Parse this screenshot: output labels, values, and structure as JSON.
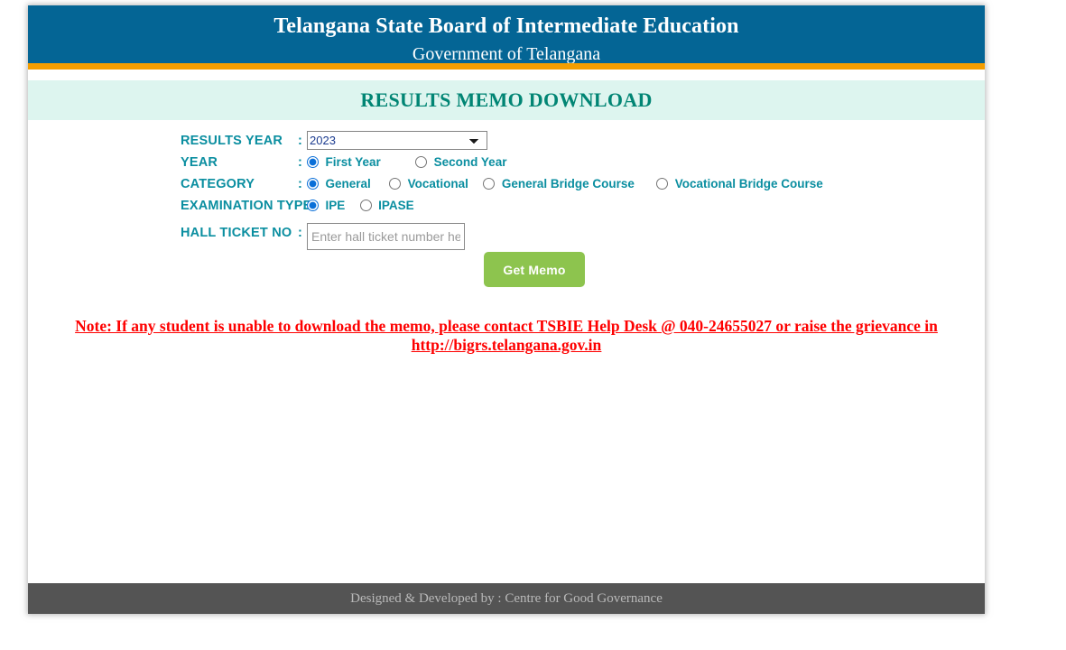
{
  "header": {
    "title": "Telangana State Board of Intermediate Education",
    "subtitle": "Government of Telangana",
    "accent_bar_color": "#f59e00",
    "background_color": "#046595"
  },
  "page_title": {
    "text": "RESULTS MEMO DOWNLOAD",
    "color": "#018574",
    "band_color": "#ddf5ef"
  },
  "form": {
    "results_year": {
      "label": "RESULTS YEAR",
      "colon": ":",
      "selected": "2023",
      "options": [
        "2023"
      ]
    },
    "year": {
      "label": "YEAR",
      "colon": ":",
      "options": [
        {
          "label": "First Year",
          "checked": true
        },
        {
          "label": "Second Year",
          "checked": false
        }
      ]
    },
    "category": {
      "label": "CATEGORY",
      "colon": ":",
      "options": [
        {
          "label": "General",
          "checked": true
        },
        {
          "label": "Vocational",
          "checked": false
        },
        {
          "label": "General Bridge Course",
          "checked": false
        },
        {
          "label": "Vocational Bridge Course",
          "checked": false
        }
      ]
    },
    "examination_type": {
      "label": "EXAMINATION TYPE",
      "colon": ":",
      "options": [
        {
          "label": "IPE",
          "checked": true
        },
        {
          "label": "IPASE",
          "checked": false
        }
      ]
    },
    "hall_ticket": {
      "label": "HALL TICKET NO",
      "colon": ":",
      "value": "",
      "placeholder": "Enter hall ticket number here"
    },
    "submit_button": {
      "label": "Get Memo",
      "color": "#8dc44e"
    },
    "label_color": "#0a8ea0"
  },
  "note": {
    "line1": "Note: If any student is unable to download the memo, please contact TSBIE Help Desk @ 040-24655027 or raise the grievance in",
    "link": "http://bigrs.telangana.gov.in",
    "color": "#fe0000"
  },
  "footer": {
    "text": "Designed & Developed by : Centre for Good Governance",
    "background_color": "#545454"
  }
}
